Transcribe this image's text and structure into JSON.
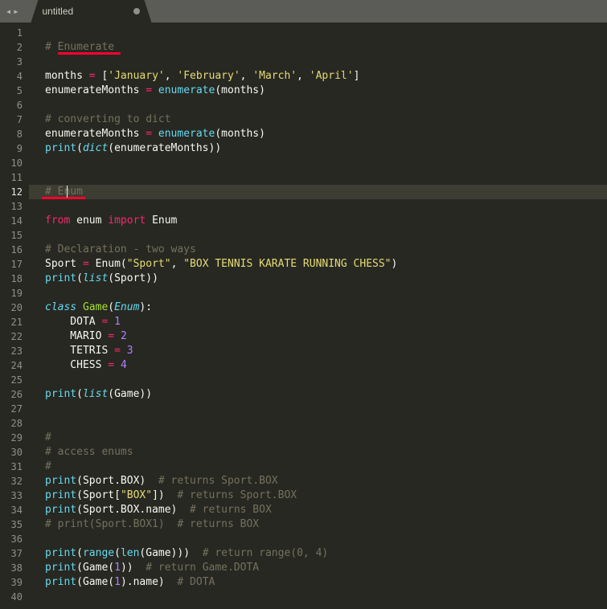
{
  "tab": {
    "title": "untitled",
    "dirty": true
  },
  "nav": {
    "left": "◂",
    "right": "▸"
  },
  "gutter": {
    "start": 1,
    "end": 40,
    "active": 12
  },
  "underline1": {
    "line": 2,
    "left_ch": 2,
    "width_ch": 10
  },
  "underline2": {
    "line": 12,
    "left_ch": 2,
    "width_ch": 7
  },
  "cursor": {
    "line": 12,
    "ch": 6
  },
  "code": {
    "1": [],
    "2": [
      [
        "comment",
        "# Enumerate"
      ]
    ],
    "3": [],
    "4": [
      [
        "plain",
        "months "
      ],
      [
        "op",
        "="
      ],
      [
        "plain",
        " ["
      ],
      [
        "string",
        "'January'"
      ],
      [
        "plain",
        ", "
      ],
      [
        "string",
        "'February'"
      ],
      [
        "plain",
        ", "
      ],
      [
        "string",
        "'March'"
      ],
      [
        "plain",
        ", "
      ],
      [
        "string",
        "'April'"
      ],
      [
        "plain",
        "]"
      ]
    ],
    "5": [
      [
        "plain",
        "enumerateMonths "
      ],
      [
        "op",
        "="
      ],
      [
        "plain",
        " "
      ],
      [
        "func",
        "enumerate"
      ],
      [
        "plain",
        "(months)"
      ]
    ],
    "6": [],
    "7": [
      [
        "comment",
        "# converting to dict"
      ]
    ],
    "8": [
      [
        "plain",
        "enumerateMonths "
      ],
      [
        "op",
        "="
      ],
      [
        "plain",
        " "
      ],
      [
        "func",
        "enumerate"
      ],
      [
        "plain",
        "(months)"
      ]
    ],
    "9": [
      [
        "func",
        "print"
      ],
      [
        "plain",
        "("
      ],
      [
        "funcit",
        "dict"
      ],
      [
        "plain",
        "(enumerateMonths))"
      ]
    ],
    "10": [],
    "11": [],
    "12": [
      [
        "comment",
        "# Enum"
      ]
    ],
    "13": [],
    "14": [
      [
        "keyword",
        "from"
      ],
      [
        "plain",
        " enum "
      ],
      [
        "keyword",
        "import"
      ],
      [
        "plain",
        " Enum"
      ]
    ],
    "15": [],
    "16": [
      [
        "comment",
        "# Declaration - two ways"
      ]
    ],
    "17": [
      [
        "plain",
        "Sport "
      ],
      [
        "op",
        "="
      ],
      [
        "plain",
        " Enum("
      ],
      [
        "string",
        "\"Sport\""
      ],
      [
        "plain",
        ", "
      ],
      [
        "string",
        "\"BOX TENNIS KARATE RUNNING CHESS\""
      ],
      [
        "plain",
        ")"
      ]
    ],
    "18": [
      [
        "func",
        "print"
      ],
      [
        "plain",
        "("
      ],
      [
        "funcit",
        "list"
      ],
      [
        "plain",
        "(Sport))"
      ]
    ],
    "19": [],
    "20": [
      [
        "storage",
        "class"
      ],
      [
        "plain",
        " "
      ],
      [
        "class",
        "Game"
      ],
      [
        "plain",
        "("
      ],
      [
        "funcit",
        "Enum"
      ],
      [
        "plain",
        "):"
      ]
    ],
    "21": [
      [
        "plain",
        "    DOTA "
      ],
      [
        "op",
        "="
      ],
      [
        "plain",
        " "
      ],
      [
        "number",
        "1"
      ]
    ],
    "22": [
      [
        "plain",
        "    MARIO "
      ],
      [
        "op",
        "="
      ],
      [
        "plain",
        " "
      ],
      [
        "number",
        "2"
      ]
    ],
    "23": [
      [
        "plain",
        "    TETRIS "
      ],
      [
        "op",
        "="
      ],
      [
        "plain",
        " "
      ],
      [
        "number",
        "3"
      ]
    ],
    "24": [
      [
        "plain",
        "    CHESS "
      ],
      [
        "op",
        "="
      ],
      [
        "plain",
        " "
      ],
      [
        "number",
        "4"
      ]
    ],
    "25": [],
    "26": [
      [
        "func",
        "print"
      ],
      [
        "plain",
        "("
      ],
      [
        "funcit",
        "list"
      ],
      [
        "plain",
        "(Game))"
      ]
    ],
    "27": [],
    "28": [],
    "29": [
      [
        "comment",
        "#"
      ]
    ],
    "30": [
      [
        "comment",
        "# access enums"
      ]
    ],
    "31": [
      [
        "comment",
        "#"
      ]
    ],
    "32": [
      [
        "func",
        "print"
      ],
      [
        "plain",
        "(Sport.BOX)  "
      ],
      [
        "comment",
        "# returns Sport.BOX"
      ]
    ],
    "33": [
      [
        "func",
        "print"
      ],
      [
        "plain",
        "(Sport["
      ],
      [
        "string",
        "\"BOX\""
      ],
      [
        "plain",
        "])  "
      ],
      [
        "comment",
        "# returns Sport.BOX"
      ]
    ],
    "34": [
      [
        "func",
        "print"
      ],
      [
        "plain",
        "(Sport.BOX.name)  "
      ],
      [
        "comment",
        "# returns BOX"
      ]
    ],
    "35": [
      [
        "comment",
        "# print(Sport.BOX1)  # returns BOX"
      ]
    ],
    "36": [],
    "37": [
      [
        "func",
        "print"
      ],
      [
        "plain",
        "("
      ],
      [
        "func",
        "range"
      ],
      [
        "plain",
        "("
      ],
      [
        "func",
        "len"
      ],
      [
        "plain",
        "(Game)))  "
      ],
      [
        "comment",
        "# return range(0, 4)"
      ]
    ],
    "38": [
      [
        "func",
        "print"
      ],
      [
        "plain",
        "(Game("
      ],
      [
        "number",
        "1"
      ],
      [
        "plain",
        "))  "
      ],
      [
        "comment",
        "# return Game.DOTA"
      ]
    ],
    "39": [
      [
        "func",
        "print"
      ],
      [
        "plain",
        "(Game("
      ],
      [
        "number",
        "1"
      ],
      [
        "plain",
        ").name)  "
      ],
      [
        "comment",
        "# DOTA"
      ]
    ],
    "40": []
  }
}
